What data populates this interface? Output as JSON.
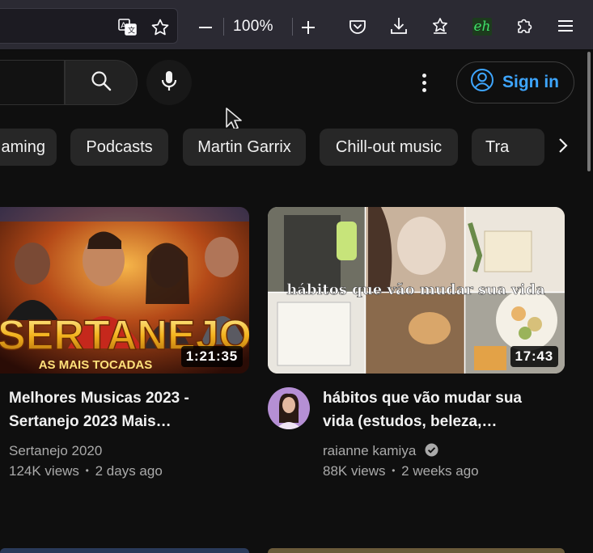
{
  "browser": {
    "zoom_level": "100%",
    "extension_eh_label": "eh"
  },
  "youtube": {
    "signin_label": "Sign in",
    "chips": [
      "aming",
      "Podcasts",
      "Martin Garrix",
      "Chill-out music",
      "Tra"
    ],
    "videos": [
      {
        "title_line1": "Melhores Musicas 2023 -",
        "title_line2": "Sertanejo 2023 Mais…",
        "channel": "Sertanejo 2020",
        "views": "124K views",
        "age": "2 days ago",
        "duration": "1:21:35",
        "thumb_text_main": "SERTANEJO",
        "thumb_text_sub": "AS MAIS TOCADAS"
      },
      {
        "title_line1": "hábitos que vão mudar sua",
        "title_line2": "vida (estudos, beleza,…",
        "channel": "raianne kamiya",
        "channel_verified": true,
        "views": "88K views",
        "age": "2 weeks ago",
        "duration": "17:43",
        "thumb_text_main": "hábitos que vão mudar sua vida"
      }
    ],
    "meta_separator": "•"
  },
  "colors": {
    "background": "#0f0f0f",
    "accent_blue": "#3ea6ff",
    "chip_bg": "#272727",
    "toolbar_bg": "#2b2a33"
  }
}
